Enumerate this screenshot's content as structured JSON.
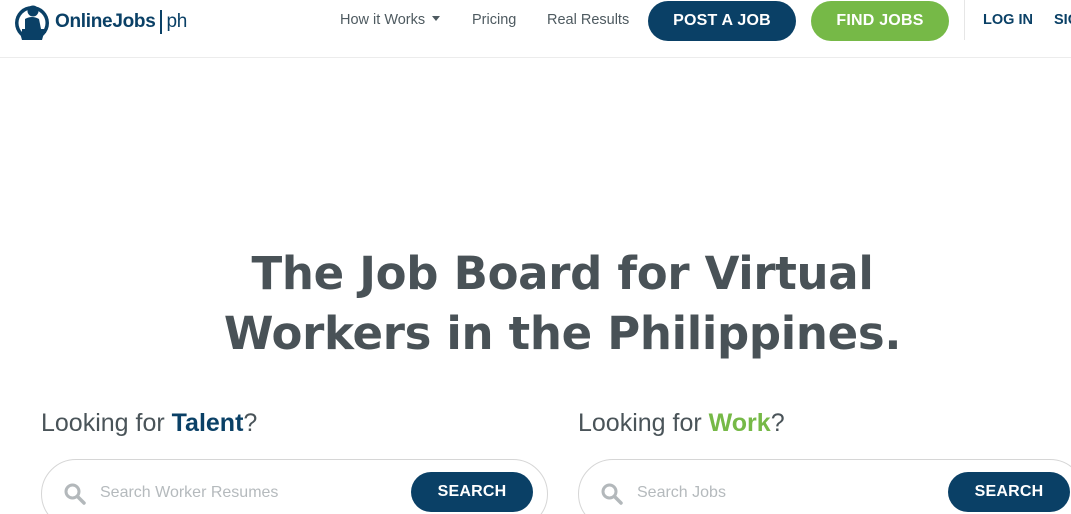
{
  "brand": {
    "name": "OnlineJobs",
    "suffix": "ph",
    "logo_icon": "worker-silhouette-icon",
    "color_primary": "#0a4066",
    "color_accent": "#76b947"
  },
  "nav": {
    "how_it_works": "How it Works",
    "pricing": "Pricing",
    "real_results": "Real Results",
    "post_job": "POST A JOB",
    "find_jobs": "FIND JOBS",
    "login": "LOG IN",
    "signup": "SIGN UP"
  },
  "hero": {
    "line1": "The Job Board for Virtual",
    "line2": "Workers in the Philippines."
  },
  "talent": {
    "prefix": "Looking for ",
    "highlight": "Talent",
    "suffix": "?",
    "placeholder": "Search Worker Resumes",
    "button": "SEARCH"
  },
  "work": {
    "prefix": "Looking for ",
    "highlight": "Work",
    "suffix": "?",
    "placeholder": "Search Jobs",
    "button": "SEARCH"
  }
}
